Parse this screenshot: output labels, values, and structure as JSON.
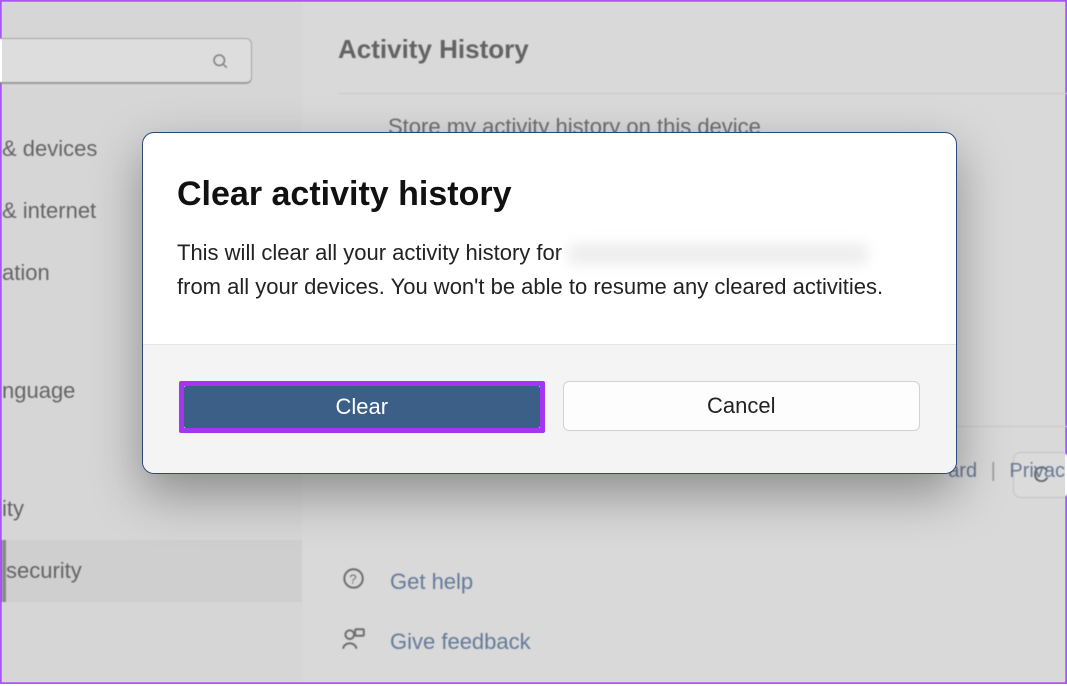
{
  "sidebar": {
    "search_placeholder": "",
    "items": [
      {
        "label": " & devices"
      },
      {
        "label": "& internet"
      },
      {
        "label": "ation"
      },
      {
        "label": "nguage"
      },
      {
        "label": "ity"
      },
      {
        "label": "security"
      }
    ]
  },
  "page": {
    "title": "Activity History",
    "setting_label": "Store my activity history on this device",
    "clear_button": "C",
    "link_dashboard": "ard",
    "link_privacy": "Privac"
  },
  "help": {
    "get_help": "Get help",
    "give_feedback": "Give feedback"
  },
  "dialog": {
    "title": "Clear activity history",
    "body_before": "This will clear all your activity history for ",
    "body_after": " from all your devices. You won't be able to resume any cleared activities.",
    "primary": "Clear",
    "secondary": "Cancel"
  }
}
